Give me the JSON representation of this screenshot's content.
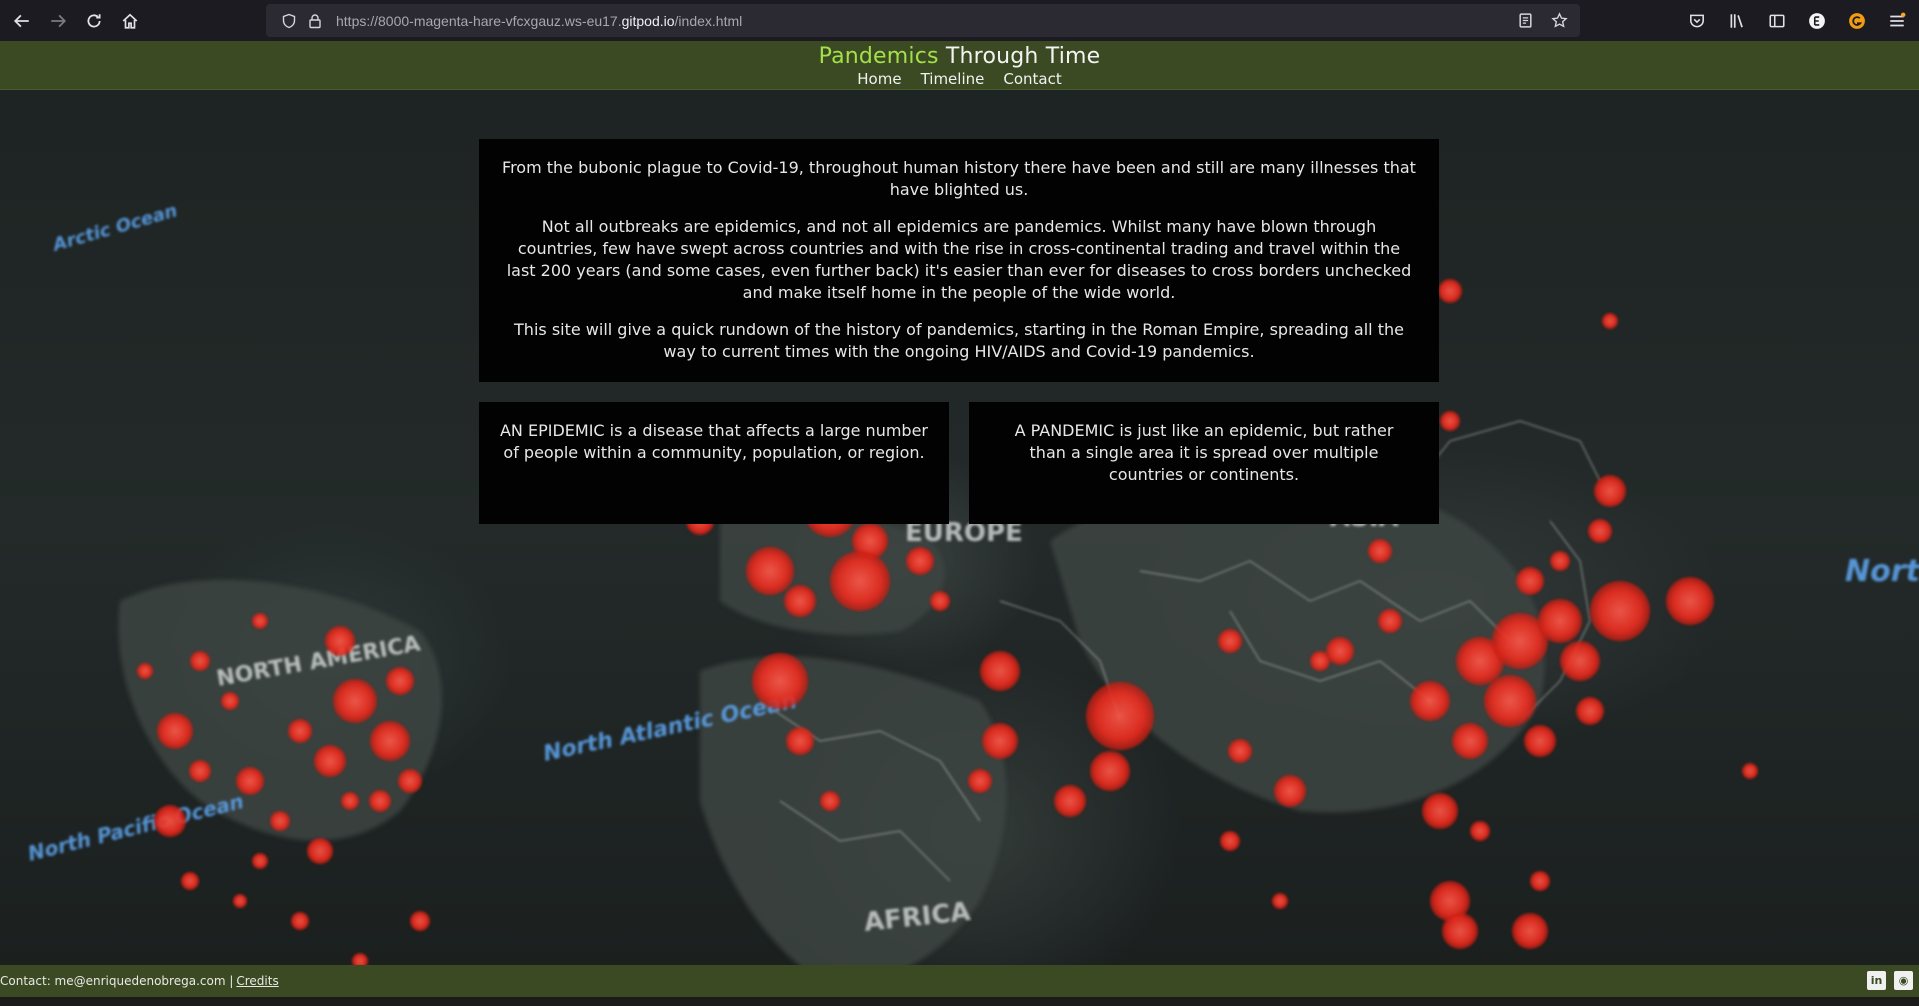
{
  "browser": {
    "url_prefix": "https://8000-magenta-hare-vfcxgauz.ws-eu17.",
    "url_domain": "gitpod.io",
    "url_path": "/index.html"
  },
  "site": {
    "title_accent": "Pandemics",
    "title_rest": " Through Time",
    "nav": [
      {
        "label": "Home"
      },
      {
        "label": "Timeline"
      },
      {
        "label": "Contact"
      }
    ]
  },
  "intro": {
    "paragraphs": [
      "From the bubonic plague to Covid-19, throughout human history there have been and still are many illnesses that have blighted us.",
      "Not all outbreaks are epidemics, and not all epidemics are pandemics. Whilst many have blown through countries, few have swept across countries and with the rise in cross-continental trading and travel within the last 200 years (and some cases, even further back) it's easier than ever for diseases to cross borders unchecked and make itself home in the people of the wide world.",
      "This site will give a quick rundown of the history of pandemics, starting in the Roman Empire, spreading all the way to current times with the ongoing HIV/AIDS and Covid-19 pandemics."
    ]
  },
  "cards": {
    "epidemic": "AN EPIDEMIC is a disease that affects a large number of people within a community, population, or region.",
    "pandemic": "A PANDEMIC is just like an epidemic, but rather than a single area it is spread over multiple countries or continents."
  },
  "footer": {
    "contact": "Contact: me@enriquedenobrega.com |",
    "credits": "Credits",
    "social": [
      {
        "icon": "linkedin-icon",
        "glyph": "in"
      },
      {
        "icon": "github-icon",
        "glyph": "◉"
      }
    ]
  },
  "map_labels": {
    "north_america": "NORTH AMERICA",
    "europe": "EUROPE",
    "asia": "ASIA",
    "africa": "AFRICA",
    "north_atlantic": "North Atlantic Ocean",
    "north_pacific": "North Pacific Ocean",
    "arctic": "Arctic Ocean"
  }
}
